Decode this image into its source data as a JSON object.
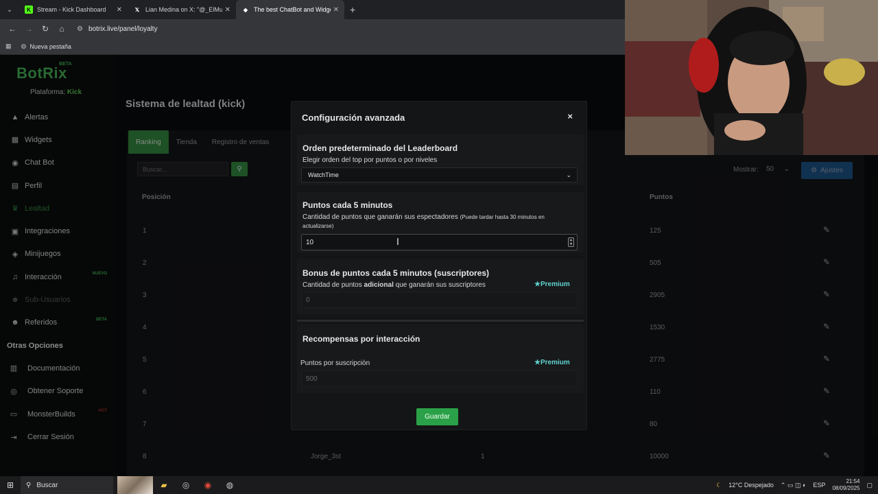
{
  "browser": {
    "tabs": [
      {
        "title": "Stream - Kick Dashboard",
        "favicon": "K",
        "color": "#53fc18"
      },
      {
        "title": "Lian Medina on X: \"@_ElMune",
        "favicon": "X",
        "color": "#000000"
      },
      {
        "title": "The best ChatBot and Widgets",
        "favicon": "◆",
        "color": "#ffffff"
      }
    ],
    "url": "botrix.live/panel/loyalty",
    "bookmark": "Nueva pestaña"
  },
  "sidebar": {
    "logo": "BotRix",
    "beta": "BETA",
    "platform_label": "Plataforma:",
    "platform_value": "Kick",
    "items": [
      {
        "label": "Alertas",
        "icon": "warning-icon"
      },
      {
        "label": "Widgets",
        "icon": "grid-icon"
      },
      {
        "label": "Chat Bot",
        "icon": "robot-icon"
      },
      {
        "label": "Perfil",
        "icon": "id-card-icon"
      },
      {
        "label": "Lealtad",
        "icon": "trophy-icon"
      },
      {
        "label": "Integraciones",
        "icon": "plug-icon"
      },
      {
        "label": "Minijuegos",
        "icon": "gamepad-icon"
      },
      {
        "label": "Interacción",
        "icon": "music-icon",
        "badge": "NUEVO"
      },
      {
        "label": "Sub-Usuarios",
        "icon": "users-icon"
      },
      {
        "label": "Referidos",
        "icon": "users-icon",
        "badge": "BETA"
      }
    ],
    "other_title": "Otras Opciones",
    "other_items": [
      {
        "label": "Documentación",
        "icon": "book-icon"
      },
      {
        "label": "Obtener Soporte",
        "icon": "support-icon"
      },
      {
        "label": "MonsterBuilds",
        "icon": "monitor-icon",
        "badge": "HOT"
      },
      {
        "label": "Cerrar Sesión",
        "icon": "logout-icon"
      }
    ]
  },
  "main": {
    "title": "Sistema de lealtad (kick)",
    "tabs": [
      "Ranking",
      "Tienda",
      "Registro de ventas"
    ],
    "search_placeholder": "Buscar...",
    "show_label": "Mostrar:",
    "show_value": "50",
    "settings_label": "Ajustes",
    "columns": {
      "position": "Posición",
      "points": "Puntos"
    },
    "rows": [
      {
        "pos": "1",
        "user": "",
        "level": "",
        "points": "125"
      },
      {
        "pos": "2",
        "user": "",
        "level": "",
        "points": "505"
      },
      {
        "pos": "3",
        "user": "",
        "level": "",
        "points": "2905"
      },
      {
        "pos": "4",
        "user": "",
        "level": "",
        "points": "1530"
      },
      {
        "pos": "5",
        "user": "",
        "level": "",
        "points": "2775"
      },
      {
        "pos": "6",
        "user": "",
        "level": "",
        "points": "110"
      },
      {
        "pos": "7",
        "user": "",
        "level": "",
        "points": "80"
      },
      {
        "pos": "8",
        "user": "Jorge_3st",
        "level": "1",
        "points": "10000"
      }
    ]
  },
  "modal": {
    "title": "Configuración avanzada",
    "close": "×",
    "leaderboard": {
      "title": "Orden predeterminado del Leaderboard",
      "desc": "Elegir orden del top por puntos o por niveles",
      "selected": "WatchTime"
    },
    "points": {
      "title": "Puntos cada 5 minutos",
      "desc": "Cantidad de puntos que ganarán sus espectadores",
      "note": "(Puede tardar hasta 30 minutos en actualizarse)",
      "value": "10"
    },
    "bonus": {
      "title": "Bonus de puntos cada 5 minutos (suscriptores)",
      "desc_pre": "Cantidad de puntos ",
      "desc_bold": "adicional",
      "desc_post": " que ganarán sus suscriptores",
      "premium": "Premium",
      "value": "0"
    },
    "rewards": {
      "title": "Recompensas por interacción",
      "label": "Puntos por suscripción",
      "premium": "Premium",
      "value": "500"
    },
    "save": "Guardar"
  },
  "taskbar": {
    "search": "Buscar",
    "weather": "12°C  Despejado",
    "lang": "ESP",
    "time": "21:54",
    "date": "08/09/2025"
  }
}
